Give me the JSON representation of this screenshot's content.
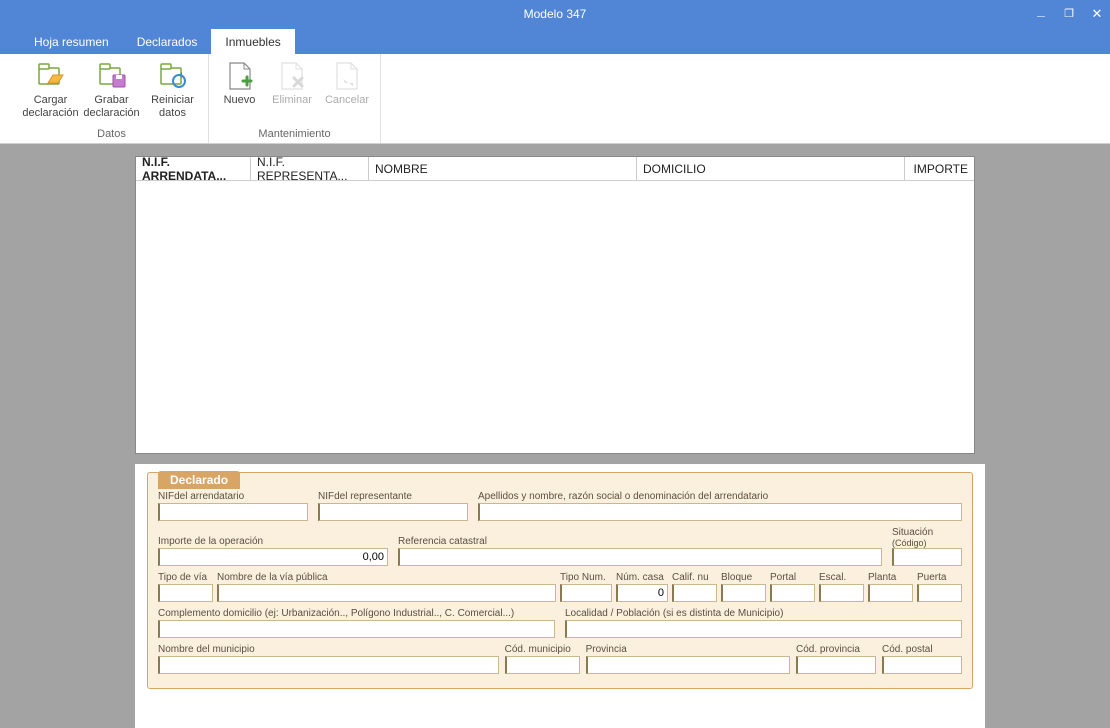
{
  "window": {
    "title": "Modelo 347"
  },
  "tabs": {
    "summary": "Hoja resumen",
    "declared": "Declarados",
    "properties": "Inmuebles"
  },
  "ribbon": {
    "group_data": "Datos",
    "group_maint": "Mantenimiento",
    "load": "Cargar declaración",
    "save": "Grabar declaración",
    "reset": "Reiniciar datos",
    "new": "Nuevo",
    "delete": "Eliminar",
    "cancel": "Cancelar"
  },
  "grid": {
    "col_nif_arr": "N.I.F. ARRENDATA...",
    "col_nif_rep": "N.I.F. REPRESENTA...",
    "col_nombre": "NOMBRE",
    "col_domicilio": "DOMICILIO",
    "col_importe": "IMPORTE"
  },
  "form": {
    "title": "Declarado",
    "nif_arr": "NIFdel arrendatario",
    "nif_rep": "NIFdel representante",
    "apellidos": "Apellidos y nombre, razón social o denominación del arrendatario",
    "importe": "Importe de la operación",
    "importe_val": "0,00",
    "ref_cat": "Referencia catastral",
    "situacion": "Situación",
    "situacion_sub": "(Código)",
    "tipo_via": "Tipo de vía",
    "nombre_via": "Nombre de la vía pública",
    "tipo_num": "Tipo Num.",
    "num_casa": "Núm. casa",
    "num_casa_val": "0",
    "calif_nu": "Calif. nu",
    "bloque": "Bloque",
    "portal": "Portal",
    "escal": "Escal.",
    "planta": "Planta",
    "puerta": "Puerta",
    "complemento": "Complemento domicilio (ej: Urbanización.., Polígono Industrial.., C. Comercial...)",
    "localidad": "Localidad / Población (si es distinta de Municipio)",
    "nombre_mun": "Nombre del municipio",
    "cod_mun": "Cód. municipio",
    "provincia": "Provincia",
    "cod_prov": "Cód. provincia",
    "cod_postal": "Cód. postal"
  }
}
